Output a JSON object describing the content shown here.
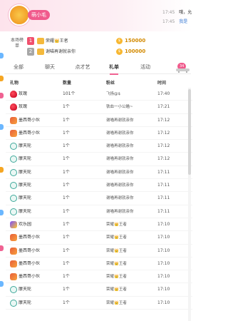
{
  "header": {
    "streamer_name": "萌小毛",
    "chat": [
      {
        "time": "17:45",
        "text": "哦，允"
      },
      {
        "time": "17:45",
        "text": "我是"
      }
    ]
  },
  "rank_box": {
    "label_top": "本场榜单",
    "label_bottom": "榜单",
    "entries": [
      {
        "rank": "1",
        "user": "荣耀👑王者",
        "value": "150000"
      },
      {
        "rank": "2",
        "user": "谢喵再谢就亲你",
        "value": "100000"
      }
    ]
  },
  "tabs": [
    {
      "label": "全部"
    },
    {
      "label": "聊天"
    },
    {
      "label": "点才艺"
    },
    {
      "label": "礼单"
    },
    {
      "label": "活动"
    }
  ],
  "tab_badge": "34",
  "table": {
    "headers": [
      "礼物",
      "数量",
      "粉丝",
      "时间"
    ],
    "rows": [
      {
        "gift": "玫瑰",
        "icon": "rose",
        "qty": "101个",
        "fan": "飞扬@$",
        "time": "17:40"
      },
      {
        "gift": "玫瑰",
        "icon": "rose",
        "qty": "1个",
        "fan": "铁血一小公瞄~",
        "time": "17:21"
      },
      {
        "gift": "墨西哥小伙",
        "icon": "bike",
        "qty": "1个",
        "fan": "谢喵再谢就亲你",
        "time": "17:12"
      },
      {
        "gift": "墨西哥小伙",
        "icon": "bike",
        "qty": "1个",
        "fan": "谢喵再谢就亲你",
        "time": "17:12"
      },
      {
        "gift": "摩天轮",
        "icon": "wheel",
        "qty": "1个",
        "fan": "谢喵再谢就亲你",
        "time": "17:12"
      },
      {
        "gift": "摩天轮",
        "icon": "wheel",
        "qty": "1个",
        "fan": "谢喵再谢就亲你",
        "time": "17:12"
      },
      {
        "gift": "摩天轮",
        "icon": "wheel",
        "qty": "1个",
        "fan": "谢喵再谢就亲你",
        "time": "17:11"
      },
      {
        "gift": "摩天轮",
        "icon": "wheel",
        "qty": "1个",
        "fan": "谢喵再谢就亲你",
        "time": "17:11"
      },
      {
        "gift": "摩天轮",
        "icon": "wheel",
        "qty": "1个",
        "fan": "谢喵再谢就亲你",
        "time": "17:11"
      },
      {
        "gift": "摩天轮",
        "icon": "wheel",
        "qty": "1个",
        "fan": "谢喵再谢就亲你",
        "time": "17:11"
      },
      {
        "gift": "欢乐园",
        "icon": "park",
        "qty": "1个",
        "fan": "荣耀👑王者",
        "time": "17:10"
      },
      {
        "gift": "墨西哥小伙",
        "icon": "bike",
        "qty": "1个",
        "fan": "荣耀👑王者",
        "time": "17:10"
      },
      {
        "gift": "墨西哥小伙",
        "icon": "bike",
        "qty": "1个",
        "fan": "荣耀👑王者",
        "time": "17:10"
      },
      {
        "gift": "墨西哥小伙",
        "icon": "bike",
        "qty": "1个",
        "fan": "荣耀👑王者",
        "time": "17:10"
      },
      {
        "gift": "墨西哥小伙",
        "icon": "bike",
        "qty": "1个",
        "fan": "荣耀👑王者",
        "time": "17:10"
      },
      {
        "gift": "摩天轮",
        "icon": "wheel",
        "qty": "1个",
        "fan": "荣耀👑王者",
        "time": "17:10"
      },
      {
        "gift": "摩天轮",
        "icon": "wheel",
        "qty": "1个",
        "fan": "荣耀👑王者",
        "time": "17:10"
      }
    ]
  },
  "colors": {
    "accent_pink": "#f05a8c",
    "rank1": "#f0506e",
    "rank2": "#a7a7a7",
    "coin": "#f7b731"
  }
}
